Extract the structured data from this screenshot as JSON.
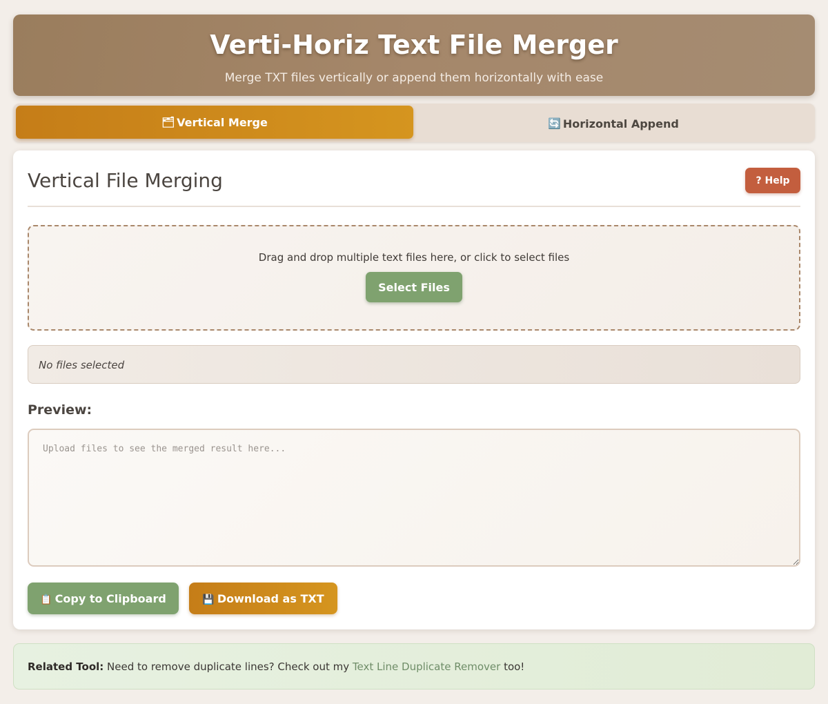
{
  "header": {
    "title": "Verti-Horiz Text File Merger",
    "subtitle": "Merge TXT files vertically or append them horizontally with ease"
  },
  "tabs": [
    {
      "label": "Vertical Merge",
      "icon": "stacked-files-icon",
      "active": true
    },
    {
      "label": "Horizontal Append",
      "icon": "refresh-arrows-icon",
      "active": false
    }
  ],
  "panel": {
    "title": "Vertical File Merging",
    "help_label": "? Help",
    "dropzone_text": "Drag and drop multiple text files here, or click to select files",
    "select_label": "Select Files",
    "file_status": "No files selected",
    "preview_label": "Preview:",
    "preview_placeholder": "Upload files to see the merged result here...",
    "copy_label": "Copy to Clipboard",
    "copy_icon": "clipboard-icon",
    "download_label": "Download as TXT",
    "download_icon": "floppy-disk-icon"
  },
  "related": {
    "prefix": "Related Tool:",
    "text_before": " Need to remove duplicate lines? Check out my ",
    "link_text": "Text Line Duplicate Remover",
    "text_after": " too!"
  },
  "colors": {
    "accent_orange": "#c57d18",
    "accent_green": "#7fa26f",
    "help_red": "#c35e3e",
    "header_brown": "#9a7d5d"
  }
}
